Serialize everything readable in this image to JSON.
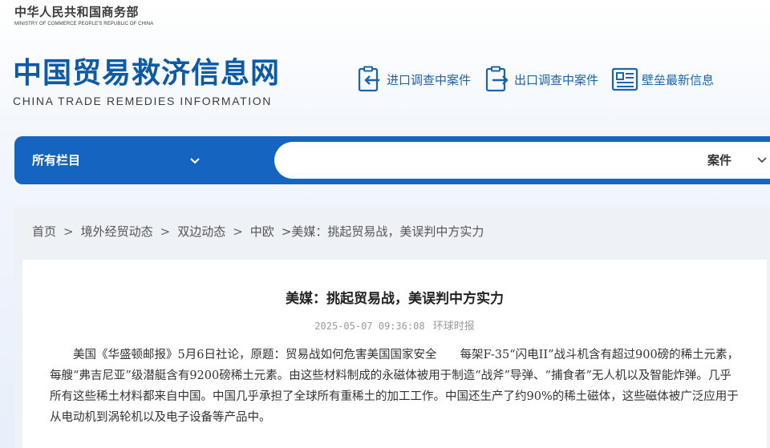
{
  "header": {
    "ministry_cn": "中华人民共和国商务部",
    "ministry_en": "MINISTRY OF COMMERCE PEOPLE'S REPUBLIC OF CHINA",
    "site_title_cn": "中国贸易救济信息网",
    "site_title_en": "CHINA TRADE REMEDIES INFORMATION",
    "quick_links": [
      {
        "label": "进口调查中案件",
        "icon": "import-case-icon"
      },
      {
        "label": "出口调查中案件",
        "icon": "export-case-icon"
      },
      {
        "label": "壁垒最新信息",
        "icon": "barrier-news-icon"
      }
    ]
  },
  "nav": {
    "all_columns_label": "所有栏目",
    "search_placeholder": "",
    "search_type_label": "案件"
  },
  "breadcrumb": [
    "首页",
    "境外经贸动态",
    "双边动态",
    "中欧"
  ],
  "breadcrumb_current": ">美媒：挑起贸易战，美误判中方实力",
  "article": {
    "title": "美媒：挑起贸易战，美误判中方实力",
    "datetime": "2025-05-07 09:36:08",
    "source": "环球时报",
    "body": "美国《华盛顿邮报》5月6日社论，原题：贸易战如何危害美国国家安全　　每架F-35“闪电II”战斗机含有超过900磅的稀土元素，每艘“弗吉尼亚”级潜艇含有9200磅稀土元素。由这些材料制成的永磁体被用于制造“战斧”导弹、“捕食者”无人机以及智能炸弹。几乎所有这些稀土材料都来自中国。中国几乎承担了全球所有重稀土的加工工作。中国还生产了约90%的稀土磁体，这些磁体被广泛应用于从电动机到涡轮机以及电子设备等产品中。"
  },
  "colors": {
    "brand_blue": "#0d5aa7",
    "nav_blue": "#1565c0",
    "link_blue": "#1d63ae"
  }
}
